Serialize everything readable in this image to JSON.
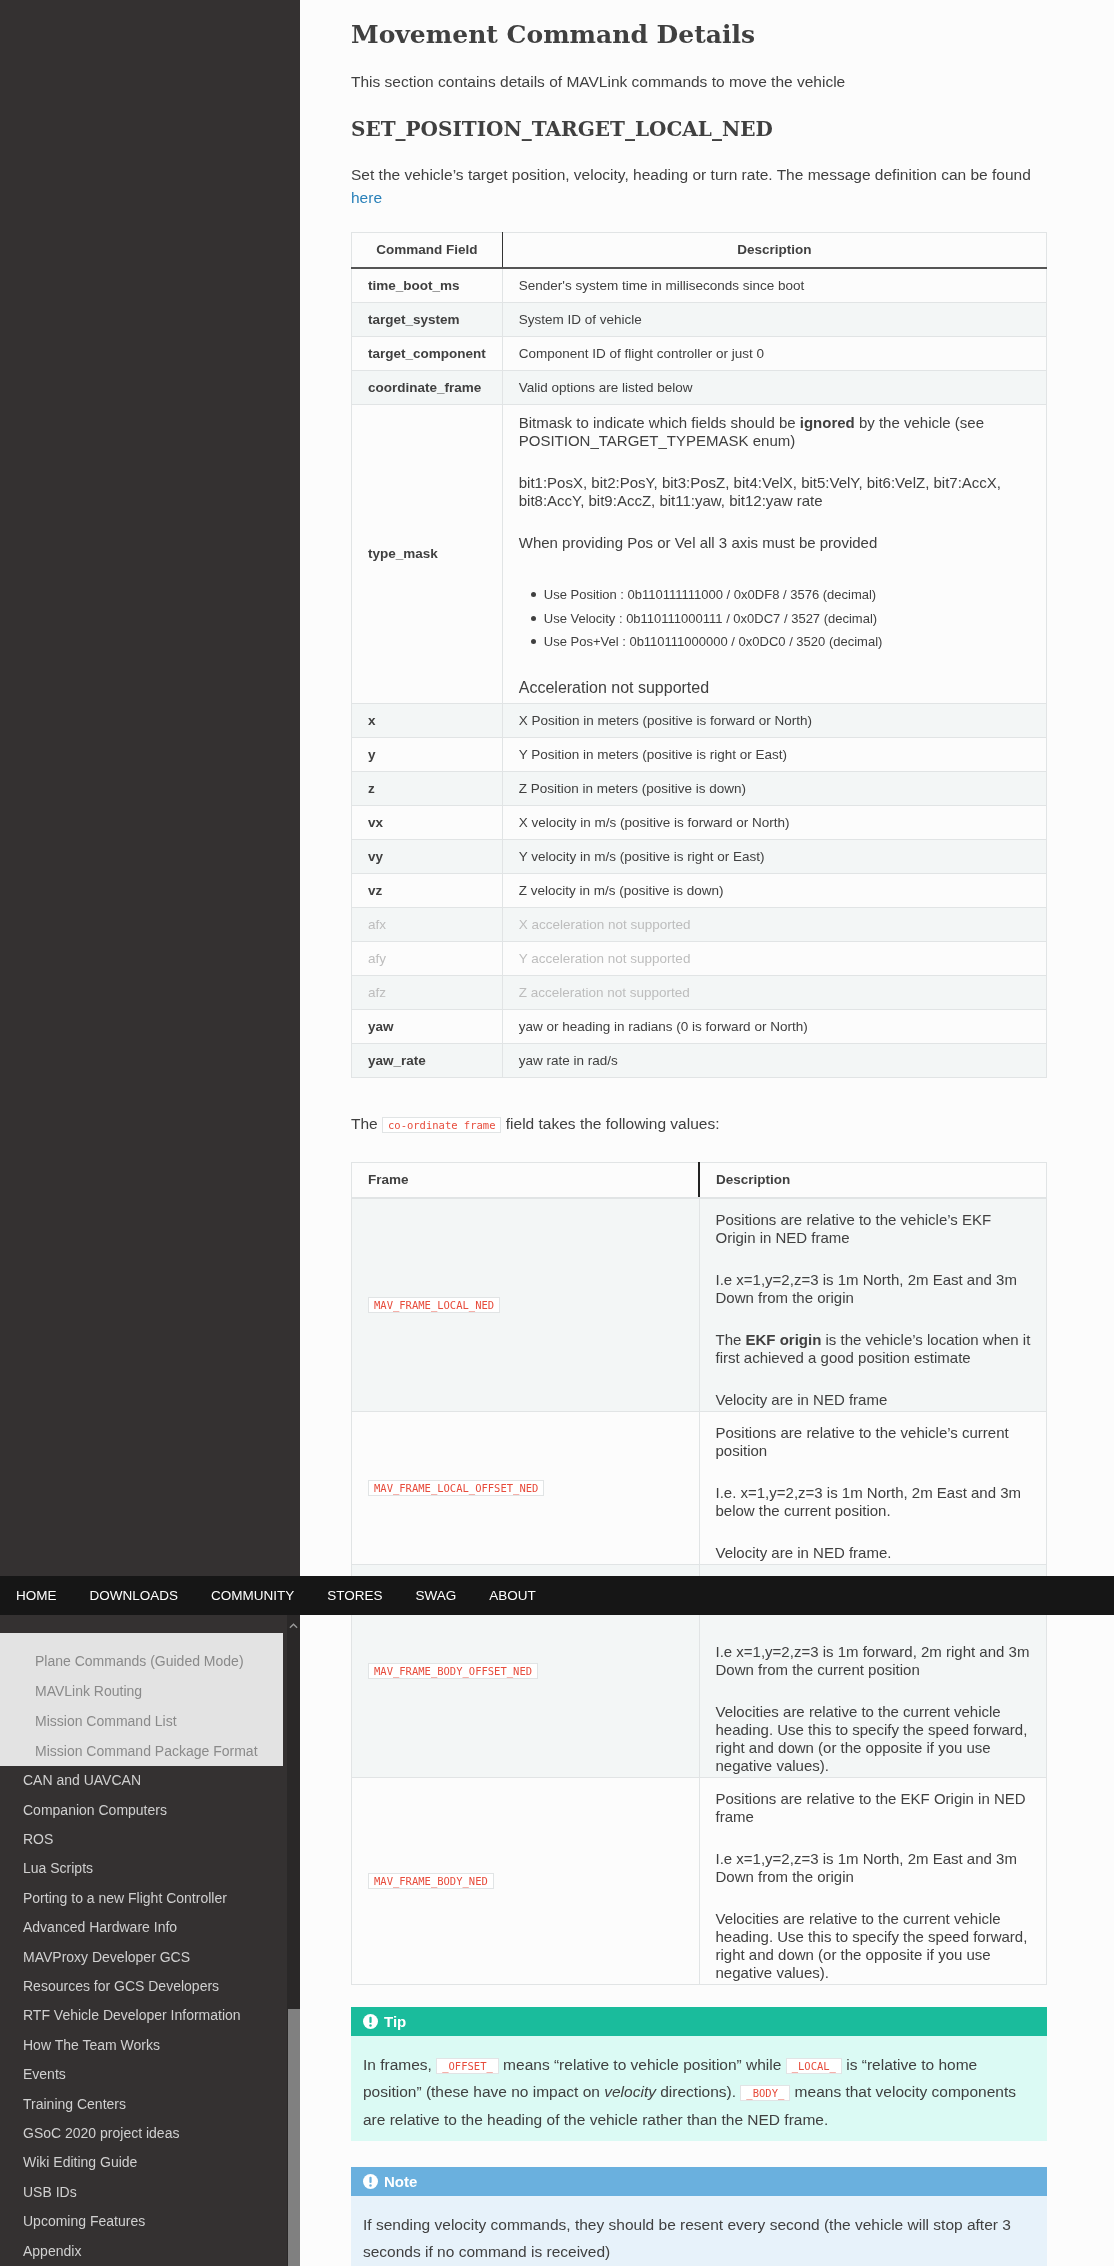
{
  "sidebar": {
    "submenu": [
      {
        "label": "Plane Commands (Guided Mode)"
      },
      {
        "label": "MAVLink Routing"
      },
      {
        "label": "Mission Command List"
      },
      {
        "label": "Mission Command Package Format"
      }
    ],
    "items": [
      {
        "label": "CAN and UAVCAN"
      },
      {
        "label": "Companion Computers"
      },
      {
        "label": "ROS"
      },
      {
        "label": "Lua Scripts"
      },
      {
        "label": "Porting to a new Flight Controller"
      },
      {
        "label": "Advanced Hardware Info"
      },
      {
        "label": "MAVProxy Developer GCS"
      },
      {
        "label": "Resources for GCS Developers"
      },
      {
        "label": "RTF Vehicle Developer Information"
      },
      {
        "label": "How The Team Works"
      },
      {
        "label": "Events"
      },
      {
        "label": "Training Centers"
      },
      {
        "label": "GSoC 2020 project ideas"
      },
      {
        "label": "Wiki Editing Guide"
      },
      {
        "label": "USB IDs"
      },
      {
        "label": "Upcoming Features"
      },
      {
        "label": "Appendix"
      }
    ]
  },
  "top_nav": {
    "items": [
      "HOME",
      "DOWNLOADS",
      "COMMUNITY",
      "STORES",
      "SWAG",
      "ABOUT"
    ]
  },
  "content": {
    "title": "Movement Command Details",
    "intro": "This section contains details of MAVLink commands to move the vehicle",
    "command_heading": "SET_POSITION_TARGET_LOCAL_NED",
    "command_text": [
      {
        "kind": "text",
        "text": "Set the vehicle’s target position, velocity, heading or turn rate. The message definition can be found "
      },
      {
        "kind": "link",
        "text": "here"
      }
    ],
    "fields_table": {
      "columns": [
        "Command Field",
        "Description"
      ],
      "rows": [
        {
          "field": "time_boot_ms",
          "disabled": false,
          "description": "Sender's system time in milliseconds since boot"
        },
        {
          "field": "target_system",
          "disabled": false,
          "description": "System ID of vehicle"
        },
        {
          "field": "target_component",
          "disabled": false,
          "description": "Component ID of flight controller or just 0"
        },
        {
          "field": "coordinate_frame",
          "disabled": false,
          "description": "Valid options are listed below"
        },
        {
          "field": "type_mask",
          "disabled": false,
          "blocks": [
            {
              "kind": "paragraph",
              "text": "Bitmask to indicate which fields should be **ignored** by the vehicle (see POSITION_TARGET_TYPEMASK enum)"
            },
            {
              "kind": "paragraph",
              "text": "bit1:PosX, bit2:PosY, bit3:PosZ, bit4:VelX, bit5:VelY, bit6:VelZ, bit7:AccX, bit8:AccY, bit9:AccZ, bit11:yaw, bit12:yaw rate"
            },
            {
              "kind": "paragraph",
              "text": "When providing Pos or Vel all 3 axis must be provided"
            },
            {
              "kind": "list",
              "items": [
                "Use Position : 0b110111111000 / 0x0DF8 / 3576 (decimal)",
                "Use Velocity : 0b110111000111 / 0x0DC7 / 3527 (decimal)",
                "Use Pos+Vel : 0b110111000000 / 0x0DC0 / 3520 (decimal)"
              ]
            },
            {
              "kind": "paragraph",
              "text": "Acceleration not supported"
            }
          ]
        },
        {
          "field": "x",
          "disabled": false,
          "description": "X Position in meters (positive is forward or North)"
        },
        {
          "field": "y",
          "disabled": false,
          "description": "Y Position in meters (positive is right or East)"
        },
        {
          "field": "z",
          "disabled": false,
          "description": "Z Position in meters (positive is down)"
        },
        {
          "field": "vx",
          "disabled": false,
          "description": "X velocity in m/s (positive is forward or North)"
        },
        {
          "field": "vy",
          "disabled": false,
          "description": "Y velocity in m/s (positive is right or East)"
        },
        {
          "field": "vz",
          "disabled": false,
          "description": "Z velocity in m/s (positive is down)"
        },
        {
          "field": "afx",
          "disabled": true,
          "description": "X acceleration not supported"
        },
        {
          "field": "afy",
          "disabled": true,
          "description": "Y acceleration not supported"
        },
        {
          "field": "afz",
          "disabled": true,
          "description": "Z acceleration not supported"
        },
        {
          "field": "yaw",
          "disabled": false,
          "description": "yaw or heading in radians (0 is forward or North)"
        },
        {
          "field": "yaw_rate",
          "disabled": false,
          "description": "yaw rate in rad/s"
        }
      ]
    },
    "frame_intro": [
      {
        "kind": "text",
        "text": "The "
      },
      {
        "kind": "code",
        "text": "co-ordinate frame"
      },
      {
        "kind": "text",
        "text": " field takes the following values:"
      }
    ],
    "frames_table": {
      "columns": [
        "Frame",
        "Description"
      ],
      "rows": [
        {
          "frame": "MAV_FRAME_LOCAL_NED",
          "description": [
            "Positions are relative to the vehicle’s EKF Origin in NED frame",
            "I.e x=1,y=2,z=3 is 1m North, 2m East and 3m Down from the origin",
            "The **EKF origin** is the vehicle’s location when it first achieved a good position estimate",
            "Velocity are in NED frame"
          ]
        },
        {
          "frame": "MAV_FRAME_LOCAL_OFFSET_NED",
          "description": [
            "Positions are relative to the vehicle’s current position",
            "I.e. x=1,y=2,z=3 is 1m North, 2m East and 3m below the current position.",
            "Velocity are in NED frame."
          ]
        },
        {
          "frame": "MAV_FRAME_BODY_OFFSET_NED",
          "description": [
            "I.e x=1,y=2,z=3 is 1m forward, 2m right and 3m Down from the current position",
            "Velocities are relative to the current vehicle heading. Use this to specify the speed forward, right and down (or the opposite if you use negative values)."
          ]
        },
        {
          "frame": "MAV_FRAME_BODY_NED",
          "description": [
            "Positions are relative to the EKF Origin in NED frame",
            "I.e x=1,y=2,z=3 is 1m North, 2m East and 3m Down from the origin",
            "Velocities are relative to the current vehicle heading. Use this to specify the speed forward, right and down (or the opposite if you use negative values)."
          ]
        }
      ]
    },
    "admonitions": [
      {
        "kind": "tip",
        "title": "Tip",
        "body": [
          {
            "kind": "text",
            "text": "In frames, "
          },
          {
            "kind": "code",
            "text": "_OFFSET_"
          },
          {
            "kind": "text",
            "text": " means “relative to vehicle position” while "
          },
          {
            "kind": "code",
            "text": "_LOCAL_"
          },
          {
            "kind": "text",
            "text": " is “relative to home position” (these have no impact on *velocity* directions). "
          },
          {
            "kind": "code",
            "text": "_BODY_"
          },
          {
            "kind": "text",
            "text": " means that velocity components are relative to the heading of the vehicle rather than the NED frame."
          }
        ]
      },
      {
        "kind": "note",
        "title": "Note",
        "body": [
          {
            "kind": "text",
            "text": "If sending velocity commands, they should be resent every second (the vehicle will stop after 3 seconds if no command is received)"
          }
        ]
      }
    ]
  }
}
